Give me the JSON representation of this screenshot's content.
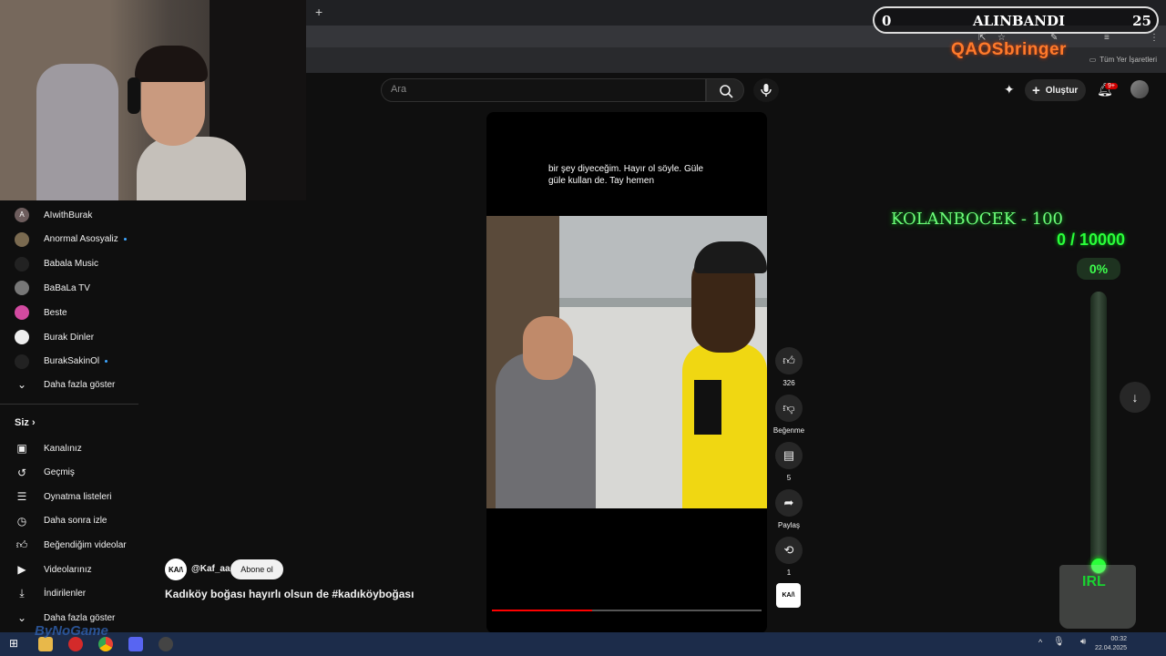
{
  "browser": {
    "new_tab": "+",
    "bookmarks_label": "Tüm Yer İşaretleri"
  },
  "header": {
    "search_placeholder": "Ara",
    "create_label": "Oluştur",
    "notif_badge": "9+"
  },
  "sidebar": {
    "subscriptions": [
      {
        "label": "AIwithBurak",
        "avatar": "A",
        "color": "#6d5d5d",
        "dot": false
      },
      {
        "label": "Anormal Asosyaliz",
        "avatar": "",
        "color": "#7a6a50",
        "dot": true
      },
      {
        "label": "Babala Music",
        "avatar": "",
        "color": "#222222",
        "dot": false
      },
      {
        "label": "BaBaLa TV",
        "avatar": "",
        "color": "#777777",
        "dot": false
      },
      {
        "label": "Beste",
        "avatar": "",
        "color": "#d24aa0",
        "dot": false
      },
      {
        "label": "Burak Dinler",
        "avatar": "",
        "color": "#eeeeee",
        "dot": false
      },
      {
        "label": "BurakSakinOl",
        "avatar": "",
        "color": "#222222",
        "dot": true
      }
    ],
    "show_more": "Daha fazla göster",
    "you_section": "Siz",
    "you_items": [
      {
        "label": "Kanalınız",
        "icon": "channel-icon"
      },
      {
        "label": "Geçmiş",
        "icon": "history-icon"
      },
      {
        "label": "Oynatma listeleri",
        "icon": "playlists-icon"
      },
      {
        "label": "Daha sonra izle",
        "icon": "watch-later-icon"
      },
      {
        "label": "Beğendiğim videolar",
        "icon": "liked-icon"
      },
      {
        "label": "Videolarınız",
        "icon": "your-videos-icon"
      },
      {
        "label": "İndirilenler",
        "icon": "downloads-icon"
      },
      {
        "label": "Daha fazla göster",
        "icon": "chevron-down-icon"
      }
    ]
  },
  "short": {
    "subtitle": "bir şey diyeceğim. Hayır ol söyle. Güle güle kullan de. Tay hemen",
    "channel_logo": "KA/\\",
    "channel_handle": "@Kaf_aa",
    "subscribe_label": "Abone ol",
    "title": "Kadıköy boğası hayırlı olsun de #kadıköyboğası",
    "progress": 0.37,
    "likes": "326",
    "dislike_label": "Beğenme",
    "comments": "5",
    "share_label": "Paylaş",
    "remix_count": "1"
  },
  "overlay": {
    "goal_left": "0",
    "goal_title": "ALINBANDI",
    "goal_right": "25",
    "brand": "QAOSbringer",
    "donor": "KOLANBOCEK - 100",
    "counter": "0 / 10000",
    "percent": "0%",
    "thermo_label": "IRL",
    "sponsor": "ByNoGame"
  },
  "taskbar": {
    "time": "00:32",
    "date": "22.04.2025"
  }
}
